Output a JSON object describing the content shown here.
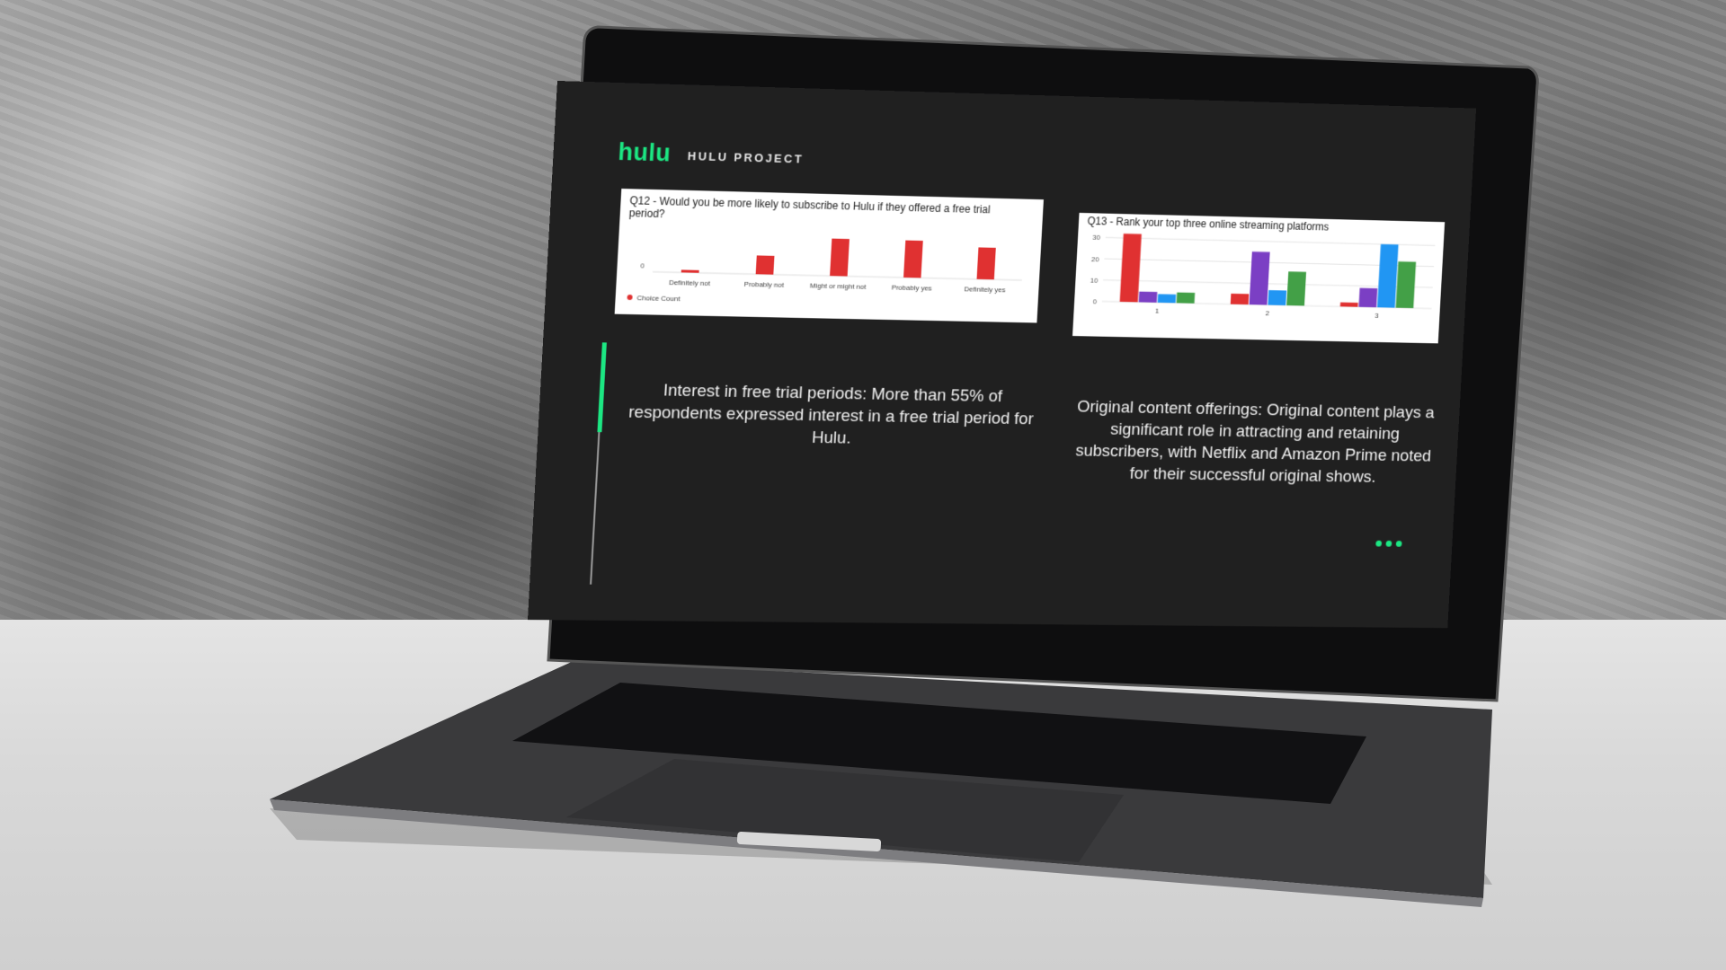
{
  "slide": {
    "brand": "hulu",
    "project_label": "HULU PROJECT",
    "left_text": "Interest  in free trial periods: More than 55% of respondents expressed interest in a free trial period for Hulu.",
    "right_text": "Original content offerings: Original content plays a significant role in attracting and retaining subscribers, with Netflix and Amazon Prime noted for their successful original shows."
  },
  "colors": {
    "accent": "#1ce783",
    "bar_red": "#e03131"
  },
  "icons": {
    "more": "more-dots-icon"
  },
  "chart_data": [
    {
      "type": "bar",
      "title": "Q12 - Would you be more likely to subscribe to Hulu if they offered a free trial period?",
      "categories": [
        "Definitely not",
        "Probably not",
        "Might or might not",
        "Probably yes",
        "Definitely yes"
      ],
      "series": [
        {
          "name": "Choice Count",
          "values": [
            1,
            7,
            14,
            14,
            12
          ]
        }
      ],
      "yticks": [
        "0"
      ],
      "legend": "bottom-left"
    },
    {
      "type": "bar",
      "title": "Q13 - Rank your top three online streaming platforms",
      "categories": [
        "1",
        "2",
        "3"
      ],
      "series": [
        {
          "values": [
            32,
            5,
            2
          ],
          "color": "#e03131"
        },
        {
          "values": [
            5,
            25,
            9
          ],
          "color": "#7b3fc4"
        },
        {
          "values": [
            4,
            7,
            30
          ],
          "color": "#2196f3"
        },
        {
          "values": [
            5,
            16,
            22
          ],
          "color": "#43a047"
        }
      ],
      "yticks": [
        "0",
        "10",
        "20",
        "30"
      ],
      "ylim": [
        0,
        33
      ]
    }
  ]
}
